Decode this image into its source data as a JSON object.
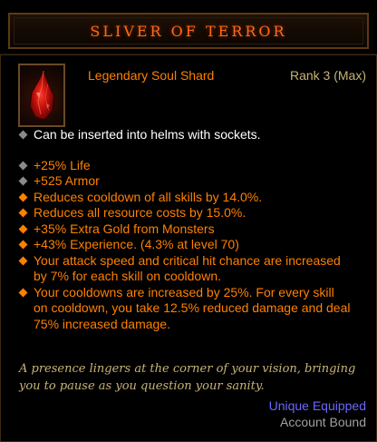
{
  "title": "Sliver of Terror",
  "item_type": "Legendary Soul Shard",
  "rank": "Rank 3 (Max)",
  "icon": "red-soul-shard-icon",
  "socket_note": "Can be inserted into helms with sockets.",
  "stats": [
    "+25% Life",
    "+525 Armor"
  ],
  "affixes": [
    "Reduces cooldown of all skills by 14.0%.",
    "Reduces all resource costs by 15.0%.",
    "+35% Extra Gold from Monsters",
    "+43% Experience. (4.3% at level 70)",
    "Your attack speed and critical hit chance are increased by 7% for each skill on cooldown.",
    "Your cooldowns are increased by 25%. For every skill on cooldown, you take 12.5% reduced damage and deal 75% increased damage."
  ],
  "affix_lines": [
    [
      "Your attack speed and critical hit chance are increased",
      "by 7% for each skill on cooldown."
    ],
    [
      "Your cooldowns are increased by 25%. For every skill",
      "on cooldown, you take 12.5% reduced damage and deal",
      "75% increased damage."
    ]
  ],
  "flavor_lines": [
    "A presence lingers at the corner of your vision, bringing",
    "you to pause as you question your sanity."
  ],
  "equip_slot": "Unique Equipped",
  "binding": "Account Bound",
  "colors": {
    "title": "#ff6a1a",
    "legendary": "#ff8000",
    "rank": "#c7b377",
    "unique": "#6969ff",
    "bound": "#a0a0a0"
  }
}
